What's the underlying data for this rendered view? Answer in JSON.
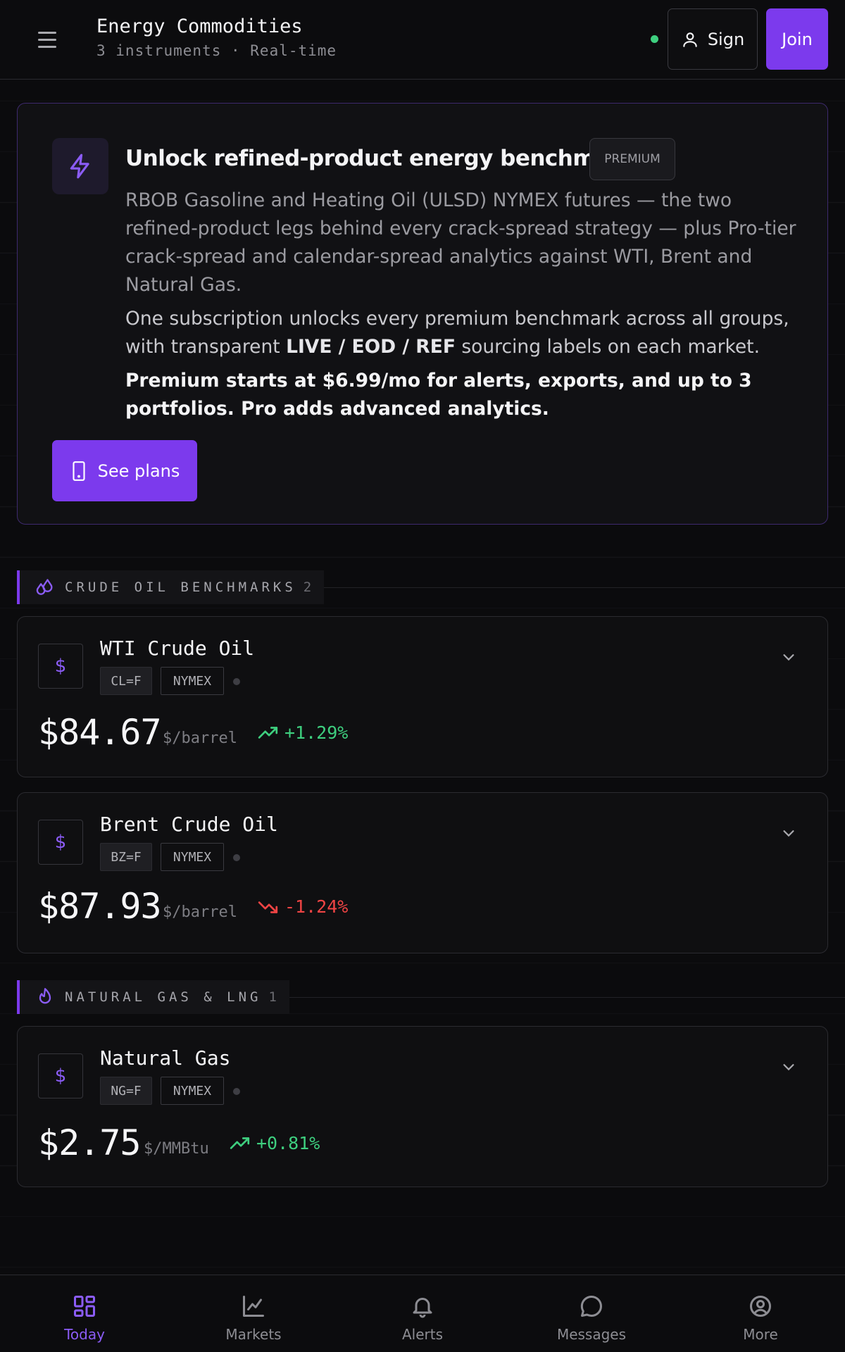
{
  "header": {
    "title": "Energy Commodities",
    "subtitle": "3 instruments · Real-time",
    "sign_label": "Sign",
    "join_label": "Join",
    "status_color": "#3ecf7f"
  },
  "promo": {
    "title": "Unlock refined-product energy benchmarks",
    "badge": "PREMIUM",
    "body": "RBOB Gasoline and Heating Oil (ULSD) NYMEX futures — the two refined-product legs behind every crack-spread strategy — plus Pro-tier crack-spread and calendar-spread analytics against WTI, Brent and Natural Gas.",
    "body2_pre": "One subscription unlocks every premium benchmark across all groups, with transparent ",
    "body2_bold": "LIVE / EOD / REF",
    "body2_post": " sourcing labels on each market.",
    "body3": "Premium starts at $6.99/mo for alerts, exports, and up to 3 portfolios. Pro adds advanced analytics.",
    "cta": "See plans",
    "icon": "lightning-icon"
  },
  "sections": [
    {
      "label": "CRUDE OIL BENCHMARKS",
      "count": "2",
      "icon": "droplets-icon"
    },
    {
      "label": "NATURAL GAS & LNG",
      "count": "1",
      "icon": "flame-icon"
    }
  ],
  "instruments": [
    {
      "name": "WTI Crude Oil",
      "symbol": "CL=F",
      "exchange": "NYMEX",
      "price": "$84.67",
      "unit": "$/barrel",
      "change": "+1.29%",
      "direction": "up"
    },
    {
      "name": "Brent Crude Oil",
      "symbol": "BZ=F",
      "exchange": "NYMEX",
      "price": "$87.93",
      "unit": "$/barrel",
      "change": "-1.24%",
      "direction": "down"
    },
    {
      "name": "Natural Gas",
      "symbol": "NG=F",
      "exchange": "NYMEX",
      "price": "$2.75",
      "unit": "$/MMBtu",
      "change": "+0.81%",
      "direction": "up"
    }
  ],
  "nav": [
    {
      "label": "Today",
      "icon": "dashboard-icon",
      "active": true
    },
    {
      "label": "Markets",
      "icon": "chart-icon"
    },
    {
      "label": "Alerts",
      "icon": "bell-icon"
    },
    {
      "label": "Messages",
      "icon": "message-icon"
    },
    {
      "label": "More",
      "icon": "profile-icon"
    }
  ],
  "colors": {
    "accent": "#7c3aed",
    "up": "#3ecf7f",
    "down": "#ef4444"
  }
}
